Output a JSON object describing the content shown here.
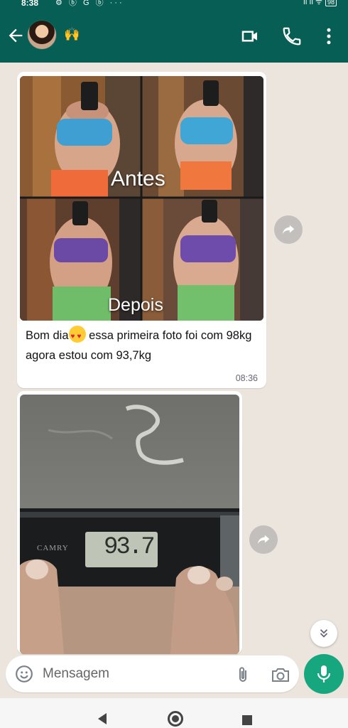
{
  "status_bar": {
    "time": "8:38",
    "notification_icons": "⚙ ⓑ G ⓑ ···",
    "signal_icons": "ıl ıl ᯤ",
    "battery": "98"
  },
  "header": {
    "contact_emoji": "🙌"
  },
  "messages": [
    {
      "photo": {
        "caption_top": "Antes",
        "caption_bottom": "Depois"
      },
      "text_part1": "Bom dia",
      "text_part2": " essa primeira foto foi com 98kg agora estou com 93,7kg",
      "time": "08:36"
    },
    {
      "photo": {
        "scale_brand": "CAMRY",
        "scale_reading": "93.7"
      }
    }
  ],
  "composer": {
    "placeholder": "Mensagem"
  },
  "colors": {
    "header": "#075e54",
    "accent": "#17a77e",
    "chat_bg": "#ece5dd",
    "bubble": "#ffffff"
  },
  "icons": {
    "header": [
      "arrow-back-icon",
      "video-call-icon",
      "phone-icon",
      "more-vert-icon"
    ],
    "bubble": [
      "forward-icon"
    ],
    "composer": [
      "emoji-icon",
      "attach-icon",
      "camera-icon",
      "mic-icon"
    ],
    "nav": [
      "nav-back-icon",
      "nav-home-icon",
      "nav-recents-icon"
    ],
    "misc": [
      "scroll-down-icon"
    ]
  }
}
